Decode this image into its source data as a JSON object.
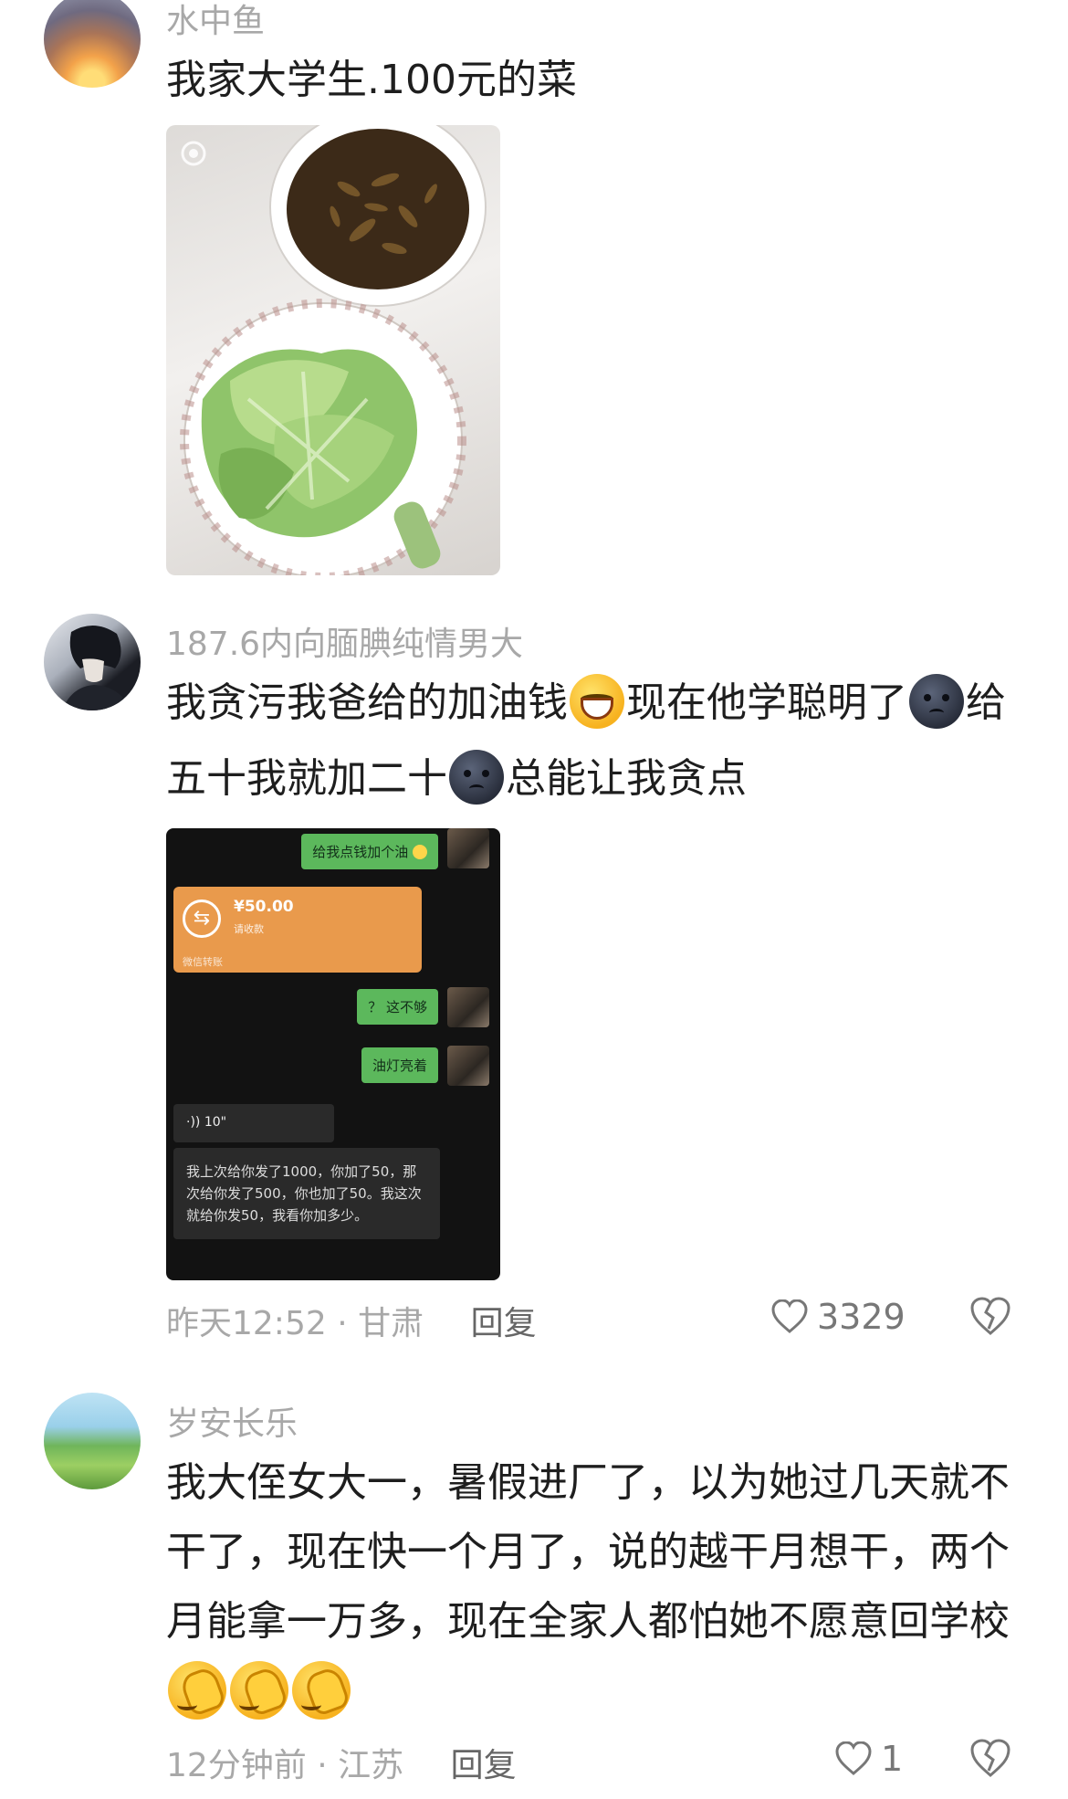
{
  "comments": [
    {
      "username": "水中鱼",
      "text": "我家大学生.100元的菜",
      "image_icon": "camera-flash-icon"
    },
    {
      "username": "187.6内向腼腆纯情男大",
      "line1_a": "我贪污我爸给的加油钱",
      "line1_b": "现在他学聪明了",
      "line1_c": "给",
      "line2_a": "五十我就加二十",
      "line2_b": "总能让我贪点",
      "chat": {
        "msg1": "给我点钱加个油",
        "transfer_amount": "¥50.00",
        "transfer_note": "请收款",
        "transfer_footer": "微信转账",
        "msg2": "？ 这不够",
        "msg3": "油灯亮着",
        "voice_length": "10\"",
        "transcript": "我上次给你发了1000，你加了50，那次给你发了500，你也加了50。我这次就给你发50，我看你加多少。"
      },
      "time": "昨天12:52",
      "location": "甘肃",
      "reply": "回复",
      "likes": "3329"
    },
    {
      "username": "岁安长乐",
      "line1": "我大侄女大一，暑假进厂了，以为她过几天就不",
      "line2": "干了，现在快一个月了，说的越干月想干，两个",
      "line3": "月能拿一万多，现在全家人都怕她不愿意回学校",
      "time": "12分钟前",
      "location": "江苏",
      "reply": "回复",
      "likes": "1"
    }
  ],
  "colors": {
    "muted": "#a8a8a8",
    "text": "#1e1e1e",
    "wechat_green": "#5cb85c",
    "transfer_orange": "#e99a4c"
  }
}
